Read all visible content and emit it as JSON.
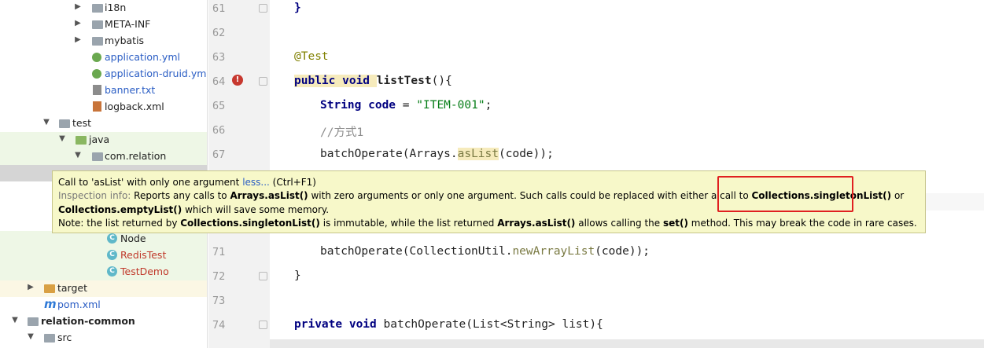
{
  "project_tree": {
    "items": [
      {
        "label": "i18n",
        "type": "folder",
        "expanded": false
      },
      {
        "label": "META-INF",
        "type": "folder",
        "expanded": false
      },
      {
        "label": "mybatis",
        "type": "folder",
        "expanded": false
      },
      {
        "label": "application.yml",
        "type": "yml"
      },
      {
        "label": "application-druid.yml",
        "type": "yml"
      },
      {
        "label": "banner.txt",
        "type": "txt"
      },
      {
        "label": "logback.xml",
        "type": "xml"
      },
      {
        "label": "test",
        "type": "folder",
        "expanded": true
      },
      {
        "label": "java",
        "type": "folder-green",
        "expanded": true
      },
      {
        "label": "com.relation",
        "type": "package",
        "expanded": true
      },
      {
        "label": "Node",
        "type": "class"
      },
      {
        "label": "RedisTest",
        "type": "class"
      },
      {
        "label": "TestDemo",
        "type": "class"
      },
      {
        "label": "target",
        "type": "folder-orange",
        "expanded": false
      },
      {
        "label": "pom.xml",
        "type": "maven"
      },
      {
        "label": "relation-common",
        "type": "module",
        "expanded": true
      },
      {
        "label": "src",
        "type": "folder",
        "expanded": true
      }
    ]
  },
  "editor": {
    "line_numbers": [
      "61",
      "62",
      "63",
      "64",
      "65",
      "66",
      "67",
      "71",
      "72",
      "73",
      "74"
    ],
    "lines": {
      "l61": "}",
      "l63": "@Test",
      "l64_kw": "public void ",
      "l64_name": "listTest",
      "l64_rest": "(){",
      "l65_type": "String",
      "l65_var": " code",
      "l65_eq": " = ",
      "l65_str": "\"ITEM-001\"",
      "l65_end": ";",
      "l66": "//方式1",
      "l67_a": "batchOperate(Arrays.",
      "l67_b": "asList",
      "l67_c": "(code));",
      "l71_a": "batchOperate(CollectionUtil.",
      "l71_b": "newArrayList",
      "l71_c": "(code));",
      "l72": "}",
      "l74_kw": "private void ",
      "l74_rest": "batchOperate(List<String> list){"
    }
  },
  "tooltip": {
    "line1_a": "Call to 'asList' with only one argument ",
    "line1_link": "less...",
    "line1_b": " (Ctrl+F1)",
    "line2_label": "Inspection info:",
    "line2_a": " Reports any calls to ",
    "line2_b": "Arrays.asList()",
    "line2_c": " with zero arguments or only one argument. Such calls could be replaced with either a call to ",
    "line2_d": "Collections.singletonList()",
    "line2_e": " or",
    "line3_a": "Collections.emptyList()",
    "line3_b": " which will save some memory.",
    "line4_a": "Note: the list returned by ",
    "line4_b": "Collections.singletonList()",
    "line4_c": " is immutable, while the list returned ",
    "line4_d": "Arrays.asList()",
    "line4_e": " allows calling the ",
    "line4_f": "set()",
    "line4_g": " method. This may break the code in rare cases."
  },
  "colors": {
    "tooltip_bg": "#f7f8c9",
    "highlight_box": "#e02020",
    "keyword": "#000080",
    "string": "#067d17"
  }
}
